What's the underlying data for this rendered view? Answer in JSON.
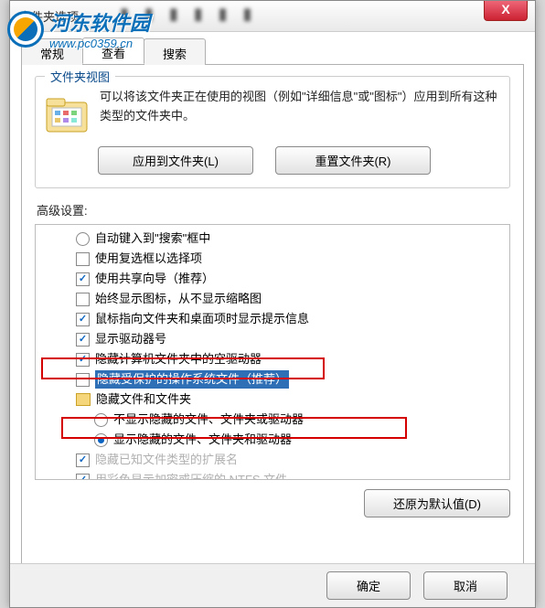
{
  "watermark": {
    "title": "河东软件园",
    "url": "www.pc0359.cn"
  },
  "window": {
    "title": "文件夹选项"
  },
  "tabs": {
    "general": "常规",
    "view": "查看",
    "search": "搜索"
  },
  "folderView": {
    "group": "文件夹视图",
    "desc": "可以将该文件夹正在使用的视图（例如\"详细信息\"或\"图标\"）应用到所有这种类型的文件夹中。",
    "apply": "应用到文件夹(L)",
    "reset": "重置文件夹(R)"
  },
  "advanced": {
    "title": "高级设置:",
    "items": [
      {
        "type": "radio",
        "checked": false,
        "label": "自动键入到\"搜索\"框中"
      },
      {
        "type": "checkbox",
        "checked": false,
        "label": "使用复选框以选择项"
      },
      {
        "type": "checkbox",
        "checked": true,
        "label": "使用共享向导（推荐）"
      },
      {
        "type": "checkbox",
        "checked": false,
        "label": "始终显示图标，从不显示缩略图"
      },
      {
        "type": "checkbox",
        "checked": true,
        "label": "鼠标指向文件夹和桌面项时显示提示信息"
      },
      {
        "type": "checkbox",
        "checked": true,
        "label": "显示驱动器号"
      },
      {
        "type": "checkbox",
        "checked": true,
        "label": "隐藏计算机文件夹中的空驱动器"
      },
      {
        "type": "checkbox",
        "checked": false,
        "label": "隐藏受保护的操作系统文件（推荐）",
        "highlight": true
      },
      {
        "type": "folder",
        "label": "隐藏文件和文件夹"
      },
      {
        "type": "radio",
        "checked": false,
        "indent": 2,
        "label": "不显示隐藏的文件、文件夹或驱动器"
      },
      {
        "type": "radio",
        "checked": true,
        "indent": 2,
        "label": "显示隐藏的文件、文件夹和驱动器"
      },
      {
        "type": "checkbox",
        "checked": true,
        "faded": true,
        "label": "隐藏已知文件类型的扩展名"
      },
      {
        "type": "checkbox",
        "checked": true,
        "faded": true,
        "label": "用彩色显示加密或压缩的 NTFS 文件"
      }
    ],
    "restore": "还原为默认值(D)"
  },
  "footer": {
    "ok": "确定",
    "cancel": "取消"
  }
}
